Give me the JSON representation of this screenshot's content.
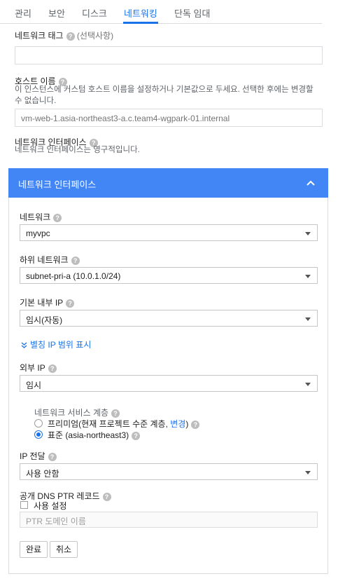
{
  "tabs": [
    "관리",
    "보안",
    "디스크",
    "네트워킹",
    "단독 임대"
  ],
  "network_tags": {
    "label": "네트워크 태그",
    "optional": "(선택사항)",
    "value": ""
  },
  "hostname": {
    "label": "호스트 이름",
    "desc_line1": "이 인스턴스에 커스텀 호스트 이름을 설정하거나 기본값으로 두세요. 선택한 후에는 변경할",
    "desc_line2": "수 없습니다.",
    "value": "vm-web-1.asia-northeast3-a.c.team4-wgpark-01.internal"
  },
  "interfaces_section": {
    "label": "네트워크 인터페이스",
    "desc": "네트워크 인터페이스는 영구적입니다."
  },
  "panel": {
    "title": "네트워크 인터페이스",
    "network": {
      "label": "네트워크",
      "value": "myvpc"
    },
    "subnet": {
      "label": "하위 네트워크",
      "value": "subnet-pri-a (10.0.1.0/24)"
    },
    "internal_ip": {
      "label": "기본 내부 IP",
      "value": "임시(자동)"
    },
    "alias_link": "별칭 IP 범위 표시",
    "external_ip": {
      "label": "외부 IP",
      "value": "임시"
    },
    "tier": {
      "label": "네트워크 서비스 계층",
      "premium": "프리미엄(현재 프로젝트 수준 계층, ",
      "premium_link": "변경",
      "premium_close": ")",
      "standard": "표준 (asia-northeast3)",
      "selected": "standard"
    },
    "ip_forwarding": {
      "label": "IP 전달",
      "value": "사용 안함"
    },
    "dns_ptr": {
      "label": "공개 DNS PTR 레코드",
      "checkbox_label": "사용 설정",
      "placeholder": "PTR 도메인 이름"
    },
    "done_label": "완료",
    "cancel_label": "취소"
  },
  "colors": {
    "accent": "#1a73e8",
    "header": "#4285f4"
  }
}
